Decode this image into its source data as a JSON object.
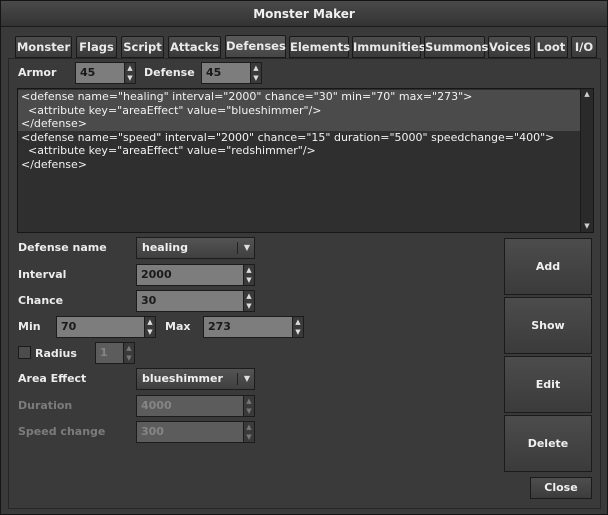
{
  "window": {
    "title": "Monster Maker"
  },
  "tabs": [
    {
      "label": "Monster"
    },
    {
      "label": "Flags"
    },
    {
      "label": "Script"
    },
    {
      "label": "Attacks"
    },
    {
      "label": "Defenses"
    },
    {
      "label": "Elements"
    },
    {
      "label": "Immunities"
    },
    {
      "label": "Summons"
    },
    {
      "label": "Voices"
    },
    {
      "label": "Loot"
    },
    {
      "label": "I/O"
    }
  ],
  "active_tab": "Defenses",
  "armor": {
    "label": "Armor",
    "value": "45"
  },
  "defense": {
    "label": "Defense",
    "value": "45"
  },
  "editor": {
    "lines": [
      "<defense name=\"healing\" interval=\"2000\" chance=\"30\" min=\"70\" max=\"273\">",
      "  <attribute key=\"areaEffect\" value=\"blueshimmer\"/>",
      "</defense>",
      "<defense name=\"speed\" interval=\"2000\" chance=\"15\" duration=\"5000\" speedchange=\"400\">",
      "  <attribute key=\"areaEffect\" value=\"redshimmer\"/>",
      "</defense>"
    ]
  },
  "form": {
    "defense_name": {
      "label": "Defense name",
      "value": "healing"
    },
    "interval": {
      "label": "Interval",
      "value": "2000"
    },
    "chance": {
      "label": "Chance",
      "value": "30"
    },
    "min": {
      "label": "Min",
      "value": "70"
    },
    "max": {
      "label": "Max",
      "value": "273"
    },
    "radius": {
      "label": "Radius",
      "value": "1",
      "checked": false
    },
    "area_effect": {
      "label": "Area Effect",
      "value": "blueshimmer"
    },
    "duration": {
      "label": "Duration",
      "value": "4000"
    },
    "speed_change": {
      "label": "Speed change",
      "value": "300"
    }
  },
  "buttons": {
    "add": "Add",
    "show": "Show",
    "edit": "Edit",
    "delete": "Delete",
    "close": "Close"
  },
  "icons": {
    "spin_up": "up-arrow-icon",
    "spin_down": "down-arrow-icon",
    "combo_caret": "chevron-down-icon"
  }
}
